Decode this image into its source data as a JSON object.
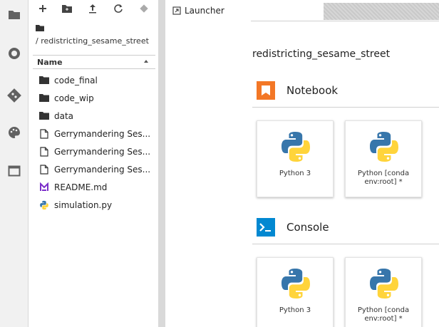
{
  "activity_bar": {
    "icons": [
      "folder-icon",
      "running-icon",
      "git-icon",
      "palette-icon",
      "tabs-icon"
    ]
  },
  "file_browser": {
    "toolbar": [
      "new-launcher-icon",
      "new-folder-icon",
      "upload-icon",
      "refresh-icon",
      "git-clone-icon"
    ],
    "breadcrumb_path": "/ redistricting_sesame_street",
    "column_name": "Name",
    "items": [
      {
        "name": "code_final",
        "kind": "folder"
      },
      {
        "name": "code_wip",
        "kind": "folder"
      },
      {
        "name": "data",
        "kind": "folder"
      },
      {
        "name": "Gerrymandering Ses...",
        "kind": "file"
      },
      {
        "name": "Gerrymandering Ses...",
        "kind": "file"
      },
      {
        "name": "Gerrymandering Ses...",
        "kind": "file"
      },
      {
        "name": "README.md",
        "kind": "markdown"
      },
      {
        "name": "simulation.py",
        "kind": "python"
      }
    ]
  },
  "tabs": {
    "launcher_label": "Launcher"
  },
  "launcher": {
    "title": "redistricting_sesame_street",
    "notebook": {
      "label": "Notebook",
      "cards": [
        "Python 3",
        "Python [conda env:root] *"
      ]
    },
    "console": {
      "label": "Console",
      "cards": [
        "Python 3",
        "Python [conda env:root] *"
      ]
    }
  },
  "colors": {
    "notebook_accent": "#f37726",
    "console_accent": "#0288d1",
    "python_blue": "#3776ab",
    "python_yellow": "#ffd43b",
    "markdown_purple": "#7b2fc9"
  }
}
